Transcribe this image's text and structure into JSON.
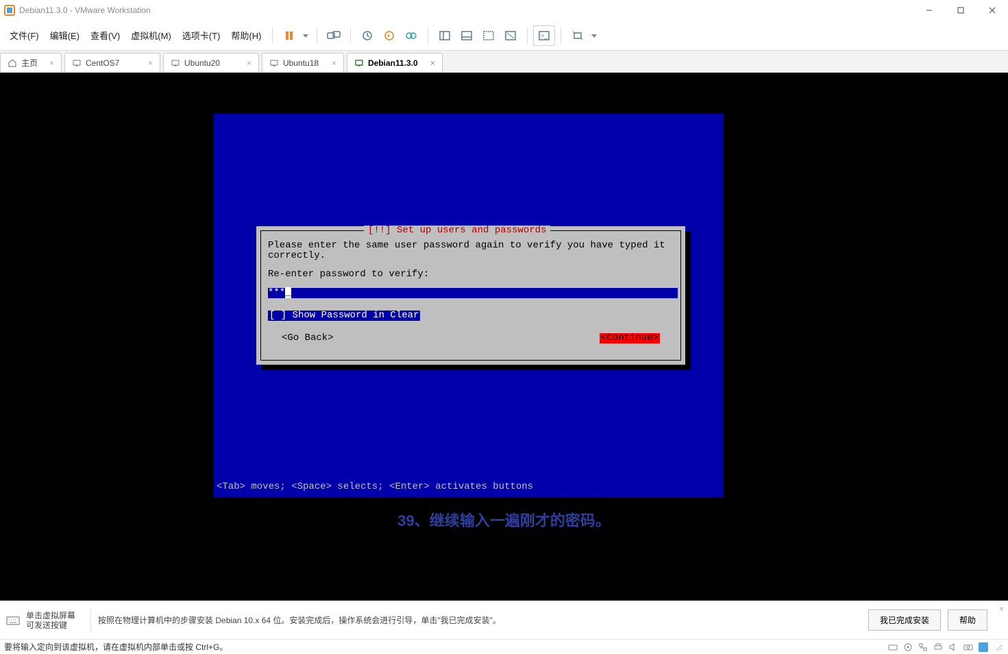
{
  "window": {
    "title": "Debian11.3.0 - VMware Workstation"
  },
  "menu": {
    "file": "文件(F)",
    "edit": "编辑(E)",
    "view": "查看(V)",
    "vm": "虚拟机(M)",
    "tabs": "选项卡(T)",
    "help": "帮助(H)"
  },
  "tabs": {
    "home": "主页",
    "t1": "CentOS7",
    "t2": "Ubuntu20",
    "t3": "Ubuntu18",
    "t4": "Debian11.3.0"
  },
  "installer": {
    "title": "[!!] Set up users and passwords",
    "line1": "Please enter the same user password again to verify you have typed it correctly.",
    "line2": "Re-enter password to verify:",
    "password_mask": "***",
    "show_pw": "[ ] Show Password in Clear",
    "go_back": "<Go Back>",
    "continue": "<Continue>",
    "help_line": "<Tab> moves; <Space> selects; <Enter> activates buttons"
  },
  "caption": "39、继续输入一遍刚才的密码。",
  "hint": {
    "title_l1": "单击虚拟屏幕",
    "title_l2": "可发送按键",
    "text": "按照在物理计算机中的步骤安装 Debian 10.x 64 位。安装完成后，操作系统会进行引导，单击\"我已完成安装\"。",
    "done_btn": "我已完成安装",
    "help_btn": "帮助"
  },
  "status": {
    "text": "要将输入定向到该虚拟机，请在虚拟机内部单击或按 Ctrl+G。"
  }
}
